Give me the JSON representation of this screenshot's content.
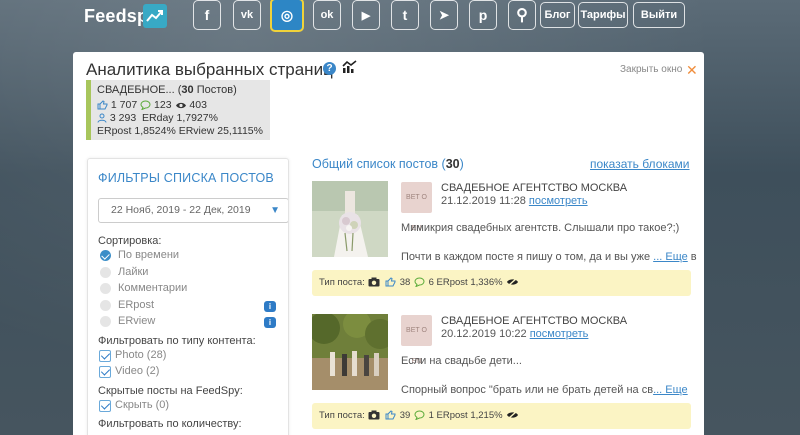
{
  "header": {
    "logo": "Feedspy",
    "social": [
      {
        "name": "facebook",
        "glyph": "f"
      },
      {
        "name": "vk",
        "glyph": "vk"
      },
      {
        "name": "instagram",
        "glyph": "◎"
      },
      {
        "name": "odnoklassniki",
        "glyph": "ok"
      },
      {
        "name": "youtube",
        "glyph": "▶"
      },
      {
        "name": "twitter",
        "glyph": "t"
      },
      {
        "name": "telegram",
        "glyph": "➤"
      },
      {
        "name": "pinterest",
        "glyph": "p"
      }
    ],
    "search_glyph": "⚲",
    "blog_label": "Блог",
    "tariffs_label": "Тарифы",
    "logout_label": "Выйти"
  },
  "panel": {
    "title": "Аналитика выбранных страниц",
    "help_glyph": "?",
    "close_label": "Закрыть окно",
    "close_glyph": "✕"
  },
  "summary": {
    "name": "СВАДЕБНОЕ...",
    "posts_count": "30",
    "posts_word": "Постов",
    "likes": "1 707",
    "comments": "123",
    "views": "403",
    "followers": "3 293",
    "erday": "ERday 1,7927%",
    "erpost_erview": "ERpost 1,8524% ERview 25,1115%"
  },
  "filters": {
    "title": "ФИЛЬТРЫ СПИСКА ПОСТОВ",
    "date_range": "22 Нояб, 2019 - 22 Дек, 2019",
    "sort_label": "Сортировка:",
    "sort_options": [
      {
        "label": "По времени",
        "selected": true
      },
      {
        "label": "Лайки",
        "selected": false
      },
      {
        "label": "Комментарии",
        "selected": false
      },
      {
        "label": "ERpost",
        "selected": false,
        "info": true
      },
      {
        "label": "ERview",
        "selected": false,
        "info": true
      }
    ],
    "content_label": "Фильтровать по типу контента:",
    "content_options": [
      {
        "label": "Photo (28)",
        "checked": true
      },
      {
        "label": "Video (2)",
        "checked": true
      }
    ],
    "hidden_label": "Скрытые посты на FeedSpy:",
    "hidden_option": "Скрыть (0)",
    "quantity_label": "Фильтровать по количеству:"
  },
  "posts_list": {
    "title": "Общий список постов",
    "count": "30",
    "blocks_link": "показать блоками",
    "items": [
      {
        "avatar_text": "BET O EN",
        "author": "СВАДЕБНОЕ АГЕНТСТВО МОСКВА",
        "date": "21.12.2019 11:28",
        "view_link": "посмотреть",
        "line1": "Мимикрия свадебных агентств. Слышали про такое?;)",
        "line2": "Почти в каждом посте я пишу о том, да и вы уже ",
        "more": "... Еще",
        "more_tail": " в",
        "type_label": "Тип поста:",
        "likes": "38",
        "comments": "6",
        "erpost": "ERpost 1,336%"
      },
      {
        "avatar_text": "BET O EN",
        "author": "СВАДЕБНОЕ АГЕНТСТВО МОСКВА",
        "date": "20.12.2019 10:22",
        "view_link": "посмотреть",
        "line1": "Если на свадьбе дети...",
        "line2": "Спорный вопрос \"брать или не брать детей на св",
        "more": "... Еще",
        "more_tail": "",
        "type_label": "Тип поста:",
        "likes": "39",
        "comments": "1",
        "erpost": "ERpost 1,215%"
      }
    ]
  }
}
